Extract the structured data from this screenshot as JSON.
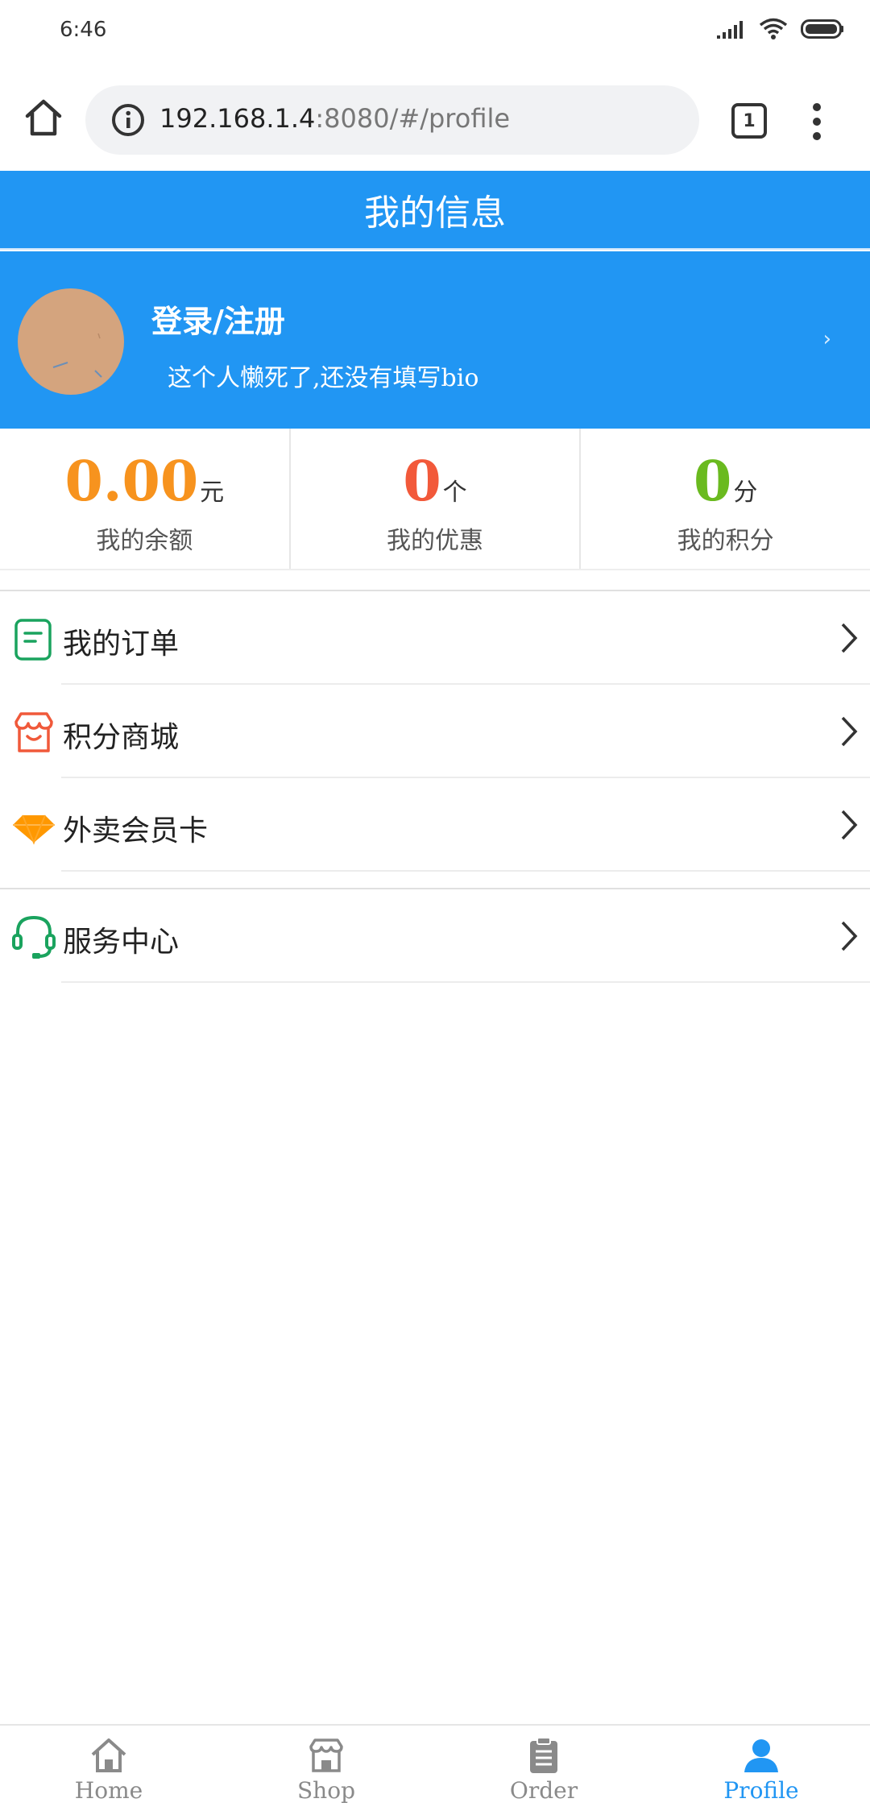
{
  "status_bar": {
    "time": "6:46"
  },
  "browser": {
    "url_host": "192.168.1.4",
    "url_rest": ":8080/#/profile",
    "tab_count": "1"
  },
  "header": {
    "title": "我的信息"
  },
  "profile": {
    "login_label": "登录/注册",
    "bio": "这个人懒死了,还没有填写bio",
    "arrow": "›"
  },
  "stats": [
    {
      "value": "0.00",
      "unit": "元",
      "label": "我的余额",
      "color": "#f7931e"
    },
    {
      "value": "0",
      "unit": "个",
      "label": "我的优惠",
      "color": "#f2593a"
    },
    {
      "value": "0",
      "unit": "分",
      "label": "我的积分",
      "color": "#6aba1f"
    }
  ],
  "menu": {
    "orders": {
      "label": "我的订单",
      "icon": "order-list-icon"
    },
    "points_mall": {
      "label": "积分商城",
      "icon": "store-icon"
    },
    "member_card": {
      "label": "外卖会员卡",
      "icon": "diamond-icon"
    },
    "service_center": {
      "label": "服务中心",
      "icon": "headset-icon"
    }
  },
  "bottom_nav": [
    {
      "label": "Home",
      "icon": "home-icon",
      "active": false
    },
    {
      "label": "Shop",
      "icon": "shop-icon",
      "active": false
    },
    {
      "label": "Order",
      "icon": "clipboard-icon",
      "active": false
    },
    {
      "label": "Profile",
      "icon": "user-icon",
      "active": true
    }
  ],
  "colors": {
    "primary": "#2196f3",
    "balance": "#f7931e",
    "coupon": "#f2593a",
    "points": "#6aba1f",
    "order_icon": "#1aa35e",
    "store_icon": "#f0593a",
    "diamond_icon": "#ff9800",
    "nav_inactive": "#8a8a8a"
  }
}
